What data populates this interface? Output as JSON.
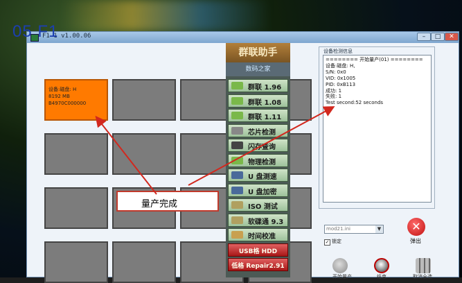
{
  "window": {
    "title": "F1-1 v1.00.06",
    "controls": {
      "minimize": "–",
      "maximize": "□",
      "close": "✕"
    }
  },
  "model_label": "05 F1",
  "slots": [
    {
      "lines": [
        "设备:磁盘: H",
        "8192 MB",
        "B4970C000000"
      ],
      "status": "active"
    },
    {
      "lines": [],
      "status": "empty"
    },
    {
      "lines": [],
      "status": "empty"
    },
    {
      "lines": [],
      "status": "empty"
    },
    {
      "lines": [],
      "status": "empty"
    },
    {
      "lines": [],
      "status": "empty"
    },
    {
      "lines": [],
      "status": "empty"
    },
    {
      "lines": [],
      "status": "empty"
    },
    {
      "lines": [],
      "status": "empty"
    },
    {
      "lines": [],
      "status": "empty"
    },
    {
      "lines": [],
      "status": "empty"
    },
    {
      "lines": [],
      "status": "empty"
    },
    {
      "lines": [],
      "status": "empty"
    },
    {
      "lines": [],
      "status": "empty"
    },
    {
      "lines": [],
      "status": "empty"
    },
    {
      "lines": [],
      "status": "empty"
    }
  ],
  "toolbar": {
    "brand": "群联助手",
    "brand_sub": "数码之家",
    "buttons": [
      {
        "label": "群联 1.96",
        "icon": "usb-drive-icon",
        "style": "green",
        "icon_color": "#7ab84a"
      },
      {
        "label": "群联 1.08",
        "icon": "usb-drive-icon",
        "style": "green",
        "icon_color": "#7ab84a"
      },
      {
        "label": "群联 1.11",
        "icon": "usb-drive-icon",
        "style": "green",
        "icon_color": "#7ab84a"
      },
      {
        "label": "芯片检测",
        "icon": "pen-icon",
        "style": "green",
        "icon_color": "#888888"
      },
      {
        "label": "闪存查询",
        "icon": "chip-icon",
        "style": "green",
        "icon_color": "#444444"
      },
      {
        "label": "物理检测",
        "icon": "usb-drive-icon",
        "style": "green",
        "icon_color": "#7ab84a"
      },
      {
        "label": "U 盘测速",
        "icon": "usb-stick-icon",
        "style": "green",
        "icon_color": "#4a6a9a"
      },
      {
        "label": "U 盘加密",
        "icon": "usb-stick-icon",
        "style": "green",
        "icon_color": "#4a6a9a"
      },
      {
        "label": "ISO 测试",
        "icon": "disc-icon",
        "style": "green",
        "icon_color": "#b0a060"
      },
      {
        "label": "软碟通 9.3",
        "icon": "disc-icon",
        "style": "green",
        "icon_color": "#b0a060"
      },
      {
        "label": "时间校准",
        "icon": "hourglass-icon",
        "style": "green",
        "icon_color": "#c8a050"
      },
      {
        "label": "USB格 HDD",
        "icon": "",
        "style": "red",
        "icon_color": ""
      },
      {
        "label": "低格 Repair2.91",
        "icon": "",
        "style": "red",
        "icon_color": ""
      }
    ]
  },
  "info_panel": {
    "title": "设备检测信息",
    "lines": [
      "======== 开始量产(01) ========",
      "设备:磁盘: H,",
      "S/N: 0x0",
      "VID: 0x1005",
      "PID: 0xB113",
      "成功: 1",
      "失败: 1",
      "Test second:52 seconds"
    ]
  },
  "mode_select": {
    "value": "mod21.ini"
  },
  "lock_checkbox": {
    "label": "锁定",
    "checked": true
  },
  "eject_button": {
    "label": "弹出"
  },
  "bottom_buttons": [
    {
      "label": "开始量产",
      "icon": "pinwheel-icon"
    },
    {
      "label": "结束",
      "icon": "stop-icon"
    },
    {
      "label": "取消全选",
      "icon": "grid-icon"
    }
  ],
  "callout": {
    "text": "量产完成"
  },
  "colors": {
    "active_slot": "#ff7a00",
    "empty_slot": "#7c7c7c",
    "arrow": "#d2281e",
    "model_label": "#1c3fb0"
  }
}
